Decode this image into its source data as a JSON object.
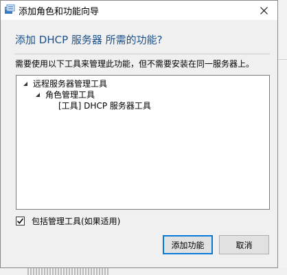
{
  "window": {
    "title": "添加角色和功能向导",
    "close_glyph": "×"
  },
  "heading": "添加 DHCP 服务器 所需的功能?",
  "description": "需要使用以下工具来管理此功能，但不需要安装在同一服务器上。",
  "tree": {
    "items": [
      {
        "label": "远程服务器管理工具",
        "level": 0,
        "expanded": true
      },
      {
        "label": "角色管理工具",
        "level": 1,
        "expanded": true
      },
      {
        "label": "[工具] DHCP 服务器工具",
        "level": 2,
        "expanded": false
      }
    ]
  },
  "checkbox": {
    "label": "包括管理工具(如果适用)",
    "checked": true
  },
  "buttons": {
    "add": "添加功能",
    "cancel": "取消"
  },
  "colors": {
    "heading": "#1b4f8a",
    "accent": "#0078d7"
  }
}
